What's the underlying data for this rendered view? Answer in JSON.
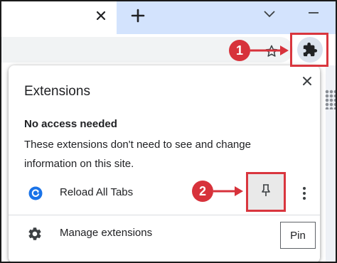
{
  "browser": {
    "tab_close_icon": "close-icon",
    "new_tab_icon": "plus-icon",
    "tab_search_icon": "chevron-down-icon",
    "minimize_icon": "minimize-icon",
    "bookmark_icon": "star-icon",
    "extensions_icon": "puzzle-icon"
  },
  "popup": {
    "title": "Extensions",
    "close_icon": "close-icon",
    "section": {
      "heading": "No access needed",
      "description": "These extensions don't need to see and change information on this site."
    },
    "extensions": [
      {
        "name": "Reload All Tabs",
        "icon": "reload-icon",
        "pin_icon": "pin-icon",
        "menu_icon": "more-vert-icon"
      }
    ],
    "manage": {
      "label": "Manage extensions",
      "icon": "gear-icon"
    },
    "tooltip": "Pin"
  },
  "annotations": {
    "step1": "1",
    "step2": "2"
  },
  "colors": {
    "accent": "#d9363e",
    "tabstrip": "#d3e3fd",
    "omnibox": "#f1f3f4",
    "extension_icon": "#1a73e8"
  }
}
